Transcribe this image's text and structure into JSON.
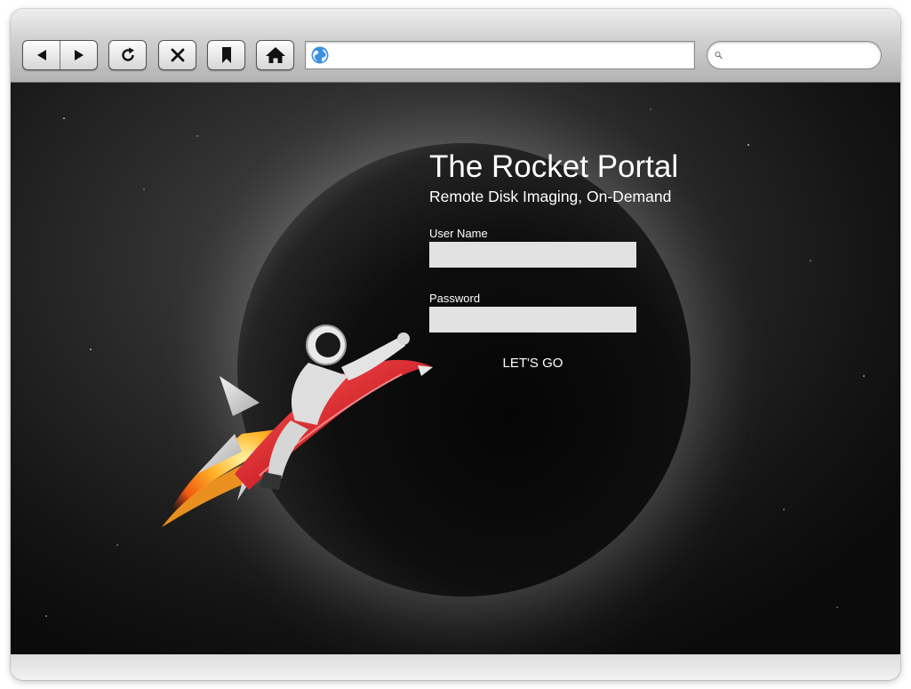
{
  "browser": {
    "nav_buttons": {
      "back": {
        "icon": "triangle-left-icon"
      },
      "forward": {
        "icon": "triangle-right-icon"
      },
      "reload": {
        "icon": "reload-icon"
      },
      "stop": {
        "icon": "close-icon"
      },
      "bookmark": {
        "icon": "bookmark-icon"
      },
      "home": {
        "icon": "home-icon"
      }
    },
    "address_bar": {
      "value": "",
      "placeholder": "",
      "icon": "globe-icon"
    },
    "search_bar": {
      "value": "",
      "placeholder": "",
      "icon": "search-icon"
    }
  },
  "page": {
    "title": "The Rocket Portal",
    "subtitle": "Remote Disk Imaging, On-Demand",
    "form": {
      "username_label": "User Name",
      "username_value": "",
      "password_label": "Password",
      "password_value": "",
      "submit_label": "LET'S GO"
    }
  },
  "colors": {
    "rocket_red": "#d0262b",
    "flame_orange": "#ff8c1a",
    "field_bg": "#e2e2e2",
    "text": "#ffffff"
  }
}
